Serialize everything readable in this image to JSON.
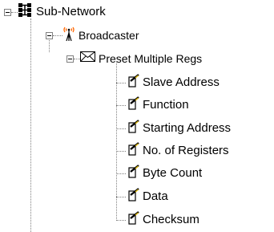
{
  "tree": {
    "root": {
      "label": "Sub-Network",
      "icon": "network-nodes-icon",
      "expanded": true,
      "children": [
        {
          "label": "Broadcaster",
          "icon": "antenna-broadcast-icon",
          "expanded": true,
          "children": [
            {
              "label": "Preset Multiple Regs",
              "icon": "envelope-icon",
              "expanded": true,
              "children": [
                {
                  "label": "Slave Address",
                  "icon": "field-pencil-icon"
                },
                {
                  "label": "Function",
                  "icon": "field-pencil-icon"
                },
                {
                  "label": "Starting Address",
                  "icon": "field-pencil-icon"
                },
                {
                  "label": "No. of Registers",
                  "icon": "field-pencil-icon"
                },
                {
                  "label": "Byte Count",
                  "icon": "field-pencil-icon"
                },
                {
                  "label": "Data",
                  "icon": "field-pencil-icon"
                },
                {
                  "label": "Checksum",
                  "icon": "field-pencil-icon"
                }
              ]
            }
          ]
        }
      ]
    }
  },
  "colors": {
    "connector": "#808080",
    "antenna_waves": "#ff6600",
    "pencil_tip": "#e8c000"
  }
}
